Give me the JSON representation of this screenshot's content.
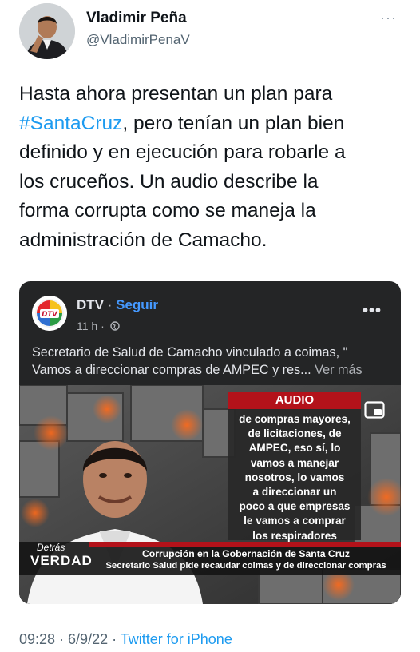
{
  "author": {
    "name": "Vladimir Peña",
    "handle": "@VladimirPenaV",
    "more": "···"
  },
  "tweet": {
    "line1": "Hasta ahora presentan un plan para",
    "hashtag": "#SantaCruz",
    "after_hashtag": ", pero tenían un plan bien",
    "line3": "definido y en ejecución para robarle a",
    "line4": "los cruceños. Un audio describe la",
    "line5": "forma corrupta como se maneja la",
    "line6": "administración de Camacho."
  },
  "embedded_post": {
    "page_name": "DTV",
    "dot": " · ",
    "follow_label": "Seguir",
    "time": "11 h ·",
    "more": "•••",
    "text_line1": "Secretario de Salud de Camacho vinculado a coimas, \"",
    "text_line2": "Vamos a direccionar compras de AMPEC y res...",
    "see_more": "Ver más",
    "video": {
      "audio_label": "AUDIO",
      "audio_lines": [
        "de compras mayores,",
        "de licitaciones, de",
        "AMPEC, eso sí, lo",
        "vamos a manejar",
        "nosotros, lo vamos",
        "a direccionar un",
        "poco a que empresas",
        "le vamos a comprar",
        "los respiradores"
      ],
      "brand_top": "Detrás",
      "brand_bottom": "VERDAD",
      "headline1": "Corrupción en la Gobernación de Santa Cruz",
      "headline2": "Secretario Salud pide recaudar coimas y de direccionar compras"
    }
  },
  "footer": {
    "time": "09:28",
    "sep1": " · ",
    "date": "6/9/22",
    "sep2": " · ",
    "source": "Twitter for iPhone"
  },
  "colors": {
    "link": "#1d9bf0",
    "card_bg": "#242526",
    "audio_red": "#b3121a"
  }
}
